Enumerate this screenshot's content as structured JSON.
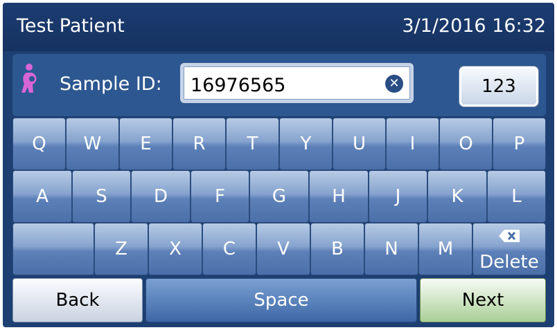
{
  "header": {
    "title": "Test Patient",
    "datetime": "3/1/2016 16:32"
  },
  "sample": {
    "label": "Sample ID:",
    "value": "16976565",
    "patient_icon": "pregnant-woman-icon",
    "clear_icon": "clear-circle-icon"
  },
  "mode_button": {
    "label": "123"
  },
  "keyboard": {
    "row1": [
      "Q",
      "W",
      "E",
      "R",
      "T",
      "Y",
      "U",
      "I",
      "O",
      "P"
    ],
    "row2": [
      "A",
      "S",
      "D",
      "F",
      "G",
      "H",
      "J",
      "K",
      "L"
    ],
    "row3": [
      "Z",
      "X",
      "C",
      "V",
      "B",
      "N",
      "M"
    ],
    "delete_label": "Delete",
    "delete_icon": "backspace-icon"
  },
  "footer": {
    "back_label": "Back",
    "space_label": "Space",
    "next_label": "Next"
  },
  "colors": {
    "background": "#1d3f72",
    "title_bar": "#163262",
    "key": "#4b6fa8",
    "next": "#a9cf96",
    "patient_icon": "#d765d6"
  }
}
